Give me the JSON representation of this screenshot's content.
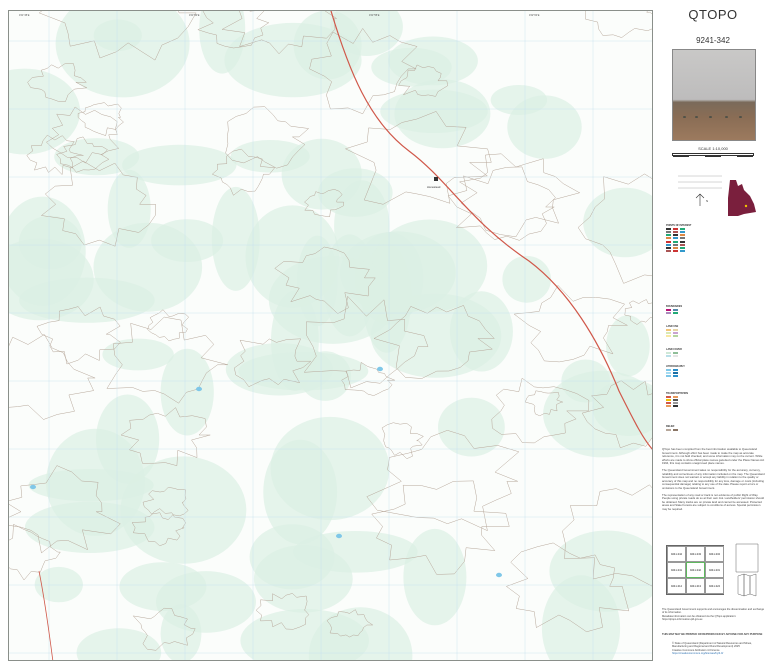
{
  "sheet": {
    "title": "QTOPO",
    "number": "9241-342",
    "scale": "SCALE 1:10,000",
    "scale_ticks": [
      "0",
      "100",
      "200",
      "300",
      "400",
      "500"
    ]
  },
  "legend": {
    "heading": "POINTS OF INTEREST",
    "sections": [
      "BOUNDARIES",
      "LAND USE",
      "LAND COVER",
      "HYDROGRAPHY",
      "TRANSPORTATION"
    ],
    "relief_heading": "RELIEF"
  },
  "disclaimer": {
    "p1": "QTopo has been compiled from the best information available to Queensland Government. Although effort has been made to make the map as accurate reference, it is not field checked, and some information may not be current. While efforts are made to show official place names gazetted under the Place Names Act 1994, this map contains unapproved place names.",
    "p2": "The Queensland Government takes no responsibility for the accuracy, currency, reliability and correctness of any information included on the map. The Queensland Government does not warrant or accept any liability in relation to the quality or accuracy of this map and no responsibility for any loss, damage or costs (including consequential damage) relating to any use of the data. Please report errors or omissions to the Queensland Government.",
    "p3": "The representation of any road or track is not evidence of public Right of Way. People using private roads do so at their own risk. Landholders' permission should be obtained. Many tracks are on private land and cannot be accessed. Protected areas and State Forests are subject to conditions of access. Special permission may be required.",
    "p4": "The Queensland Government supports and encourages the dissemination and exchange of its information.",
    "p5": "Metadata information can be obtained via the QTopo application: https://qtopo.information.qld.gov.au"
  },
  "footer": {
    "warning": "THIS MAP MAY BE PRINTED OR REPRODUCED BY ANYONE FOR ANY PURPOSE",
    "copyright": "© State of Queensland (Department of Natural Resources and Mines, Manufacturing and Regional and Rural Development) 2025",
    "licence": "Creative Commons Attribution 4.0 licence",
    "link": "https://creativecommons.org/licenses/by/4.0/"
  },
  "index_sheets": [
    "9241-344",
    "9241-343",
    "9241-334",
    "9241-341",
    "9241-342",
    "9241-331",
    "9241-314",
    "9241-313",
    "9241-324"
  ],
  "map_labels": {
    "homestead": "Homestead"
  },
  "colors": {
    "vegetation": "#dcefe4",
    "contour": "#b7a79a",
    "road": "#d0584a",
    "water": "#7fc7e8",
    "grid": "#c4dff0",
    "accent_qld": "#7a1f3d"
  }
}
